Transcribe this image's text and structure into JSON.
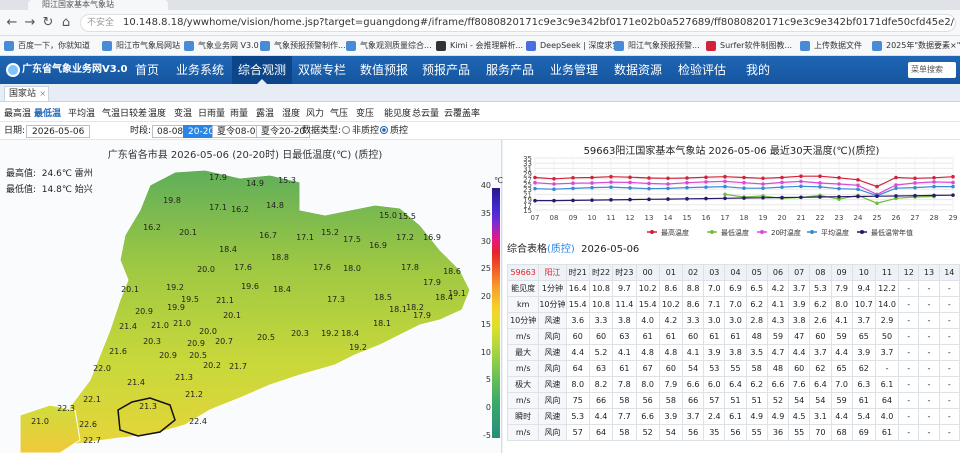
{
  "browser": {
    "tab_title": "阳江国家基本气象站",
    "url": "10.148.8.18/ywwhome/vision/home.jsp?target=guangdong#/iframe/ff8080820171c9e3c9e342bf0171e02b0a527689/ff8080820171c9e3c9e342bf0171dfe50cfd45e2/ff808082017512541254959d017517a0d43b630",
    "insecure_label": "不安全",
    "bookmarks": [
      "百度一下，你就知道",
      "阳江市气象局网站",
      "气象业务网 V3.0",
      "气象预报预警制作...",
      "气象观测质量综合...",
      "Kimi - 会推理解析...",
      "DeepSeek | 深度求索",
      "阳江气象预报预警...",
      "Surfer软件制图教...",
      "上传数据文件",
      "2025年\"数据要素×\"..."
    ]
  },
  "header": {
    "logo": "广东省气象业务网V3.0",
    "menu": [
      "首页",
      "业务系统",
      "综合观测",
      "双碳专栏",
      "数值预报",
      "预报产品",
      "服务产品",
      "业务管理",
      "数据资源",
      "检验评估",
      "我的"
    ],
    "active_menu": "综合观测",
    "search_placeholder": "菜单搜索"
  },
  "tabs": {
    "station_tab": "国家站"
  },
  "elements": {
    "items": [
      "最高温",
      "最低温",
      "平均温",
      "气温日较差",
      "温度",
      "变温",
      "日雨量",
      "雨量",
      "露温",
      "湿度",
      "风力",
      "气压",
      "变压",
      "能见度",
      "总云量",
      "云覆盖率"
    ],
    "active": "最低温"
  },
  "controls": {
    "date_label": "日期:",
    "date_value": "2026-05-06",
    "time_label": "时段:",
    "time_options": [
      "08-08",
      "20-20",
      "夏令08-08",
      "夏令20-20"
    ],
    "active_time": "20-20",
    "data_type_label": "数据类型:",
    "data_type_options": [
      "非质控",
      "质控"
    ],
    "active_data_type": "质控"
  },
  "map": {
    "title": "广东省各市县 2026-05-06 (20-20时) 日最低温度(℃) (质控)",
    "max_label": "最高值:",
    "max_value": "24.6℃ 雷州",
    "min_label": "最低值:",
    "min_value": "14.8℃ 始兴",
    "legend_unit": "℃",
    "legend_ticks": [
      "40",
      "35",
      "30",
      "25",
      "20",
      "15",
      "10",
      "5",
      "0",
      "-5"
    ],
    "stations": [
      "17.9",
      "14.9",
      "15.3",
      "19.8",
      "17.1",
      "16.2",
      "14.8",
      "15.0",
      "15.5",
      "16.2",
      "20.1",
      "16.7",
      "17.1",
      "15.2",
      "17.5",
      "16.9",
      "17.2",
      "16.9",
      "18.4",
      "20.0",
      "17.6",
      "18.8",
      "17.6",
      "18.0",
      "17.8",
      "18.6",
      "17.9",
      "20.1",
      "19.2",
      "19.6",
      "18.4",
      "19.9",
      "17.3",
      "18.5",
      "18.4",
      "19.5",
      "21.1",
      "18.1",
      "18.2",
      "19.1",
      "20.9",
      "21.0",
      "20.1",
      "18.1",
      "17.9",
      "21.4",
      "21.0",
      "20.0",
      "20.3",
      "19.2",
      "18.4",
      "20.3",
      "20.9",
      "20.7",
      "20.5",
      "19.2",
      "21.6",
      "20.9",
      "20.5",
      "22.0",
      "21.4",
      "21.3",
      "20.2",
      "21.7",
      "22.1",
      "21.2",
      "22.3",
      "21.3",
      "22.4",
      "22.6",
      "22.7",
      "21.0"
    ]
  },
  "chart_data": {
    "type": "line",
    "title": "59663阳江国家基本气象站  2026-05-06  最近30天温度(℃)(质控)",
    "x": [
      "07",
      "08",
      "09",
      "10",
      "11",
      "12",
      "13",
      "14",
      "15",
      "16",
      "17",
      "18",
      "19",
      "20",
      "21",
      "22",
      "23",
      "24",
      "25",
      "26",
      "27",
      "28",
      "29"
    ],
    "ylim": [
      15,
      35
    ],
    "yticks": [
      15,
      17,
      19,
      21,
      23,
      25,
      27,
      29,
      31,
      33,
      35
    ],
    "series": [
      {
        "name": "最高温度",
        "color": "#d2233b",
        "values": [
          27.5,
          27.0,
          27.4,
          27.5,
          27.8,
          27.6,
          27.3,
          27.2,
          27.3,
          27.6,
          27.8,
          27.5,
          27.2,
          27.5,
          28.0,
          28.0,
          27.4,
          26.6,
          24.0,
          27.5,
          27.2,
          27.4,
          27.8
        ]
      },
      {
        "name": "最低温度",
        "color": "#6fbf3a",
        "values": [
          null,
          null,
          null,
          null,
          null,
          null,
          null,
          null,
          null,
          null,
          21.0,
          20.0,
          20.4,
          19.5,
          19.8,
          20.6,
          19.2,
          20.6,
          17.6,
          19.5,
          20.0,
          20.2,
          null
        ]
      },
      {
        "name": "20时温度",
        "color": "#d84ad8",
        "values": [
          25.5,
          25.0,
          25.3,
          25.4,
          25.7,
          25.6,
          25.2,
          25.0,
          25.5,
          25.8,
          26.0,
          25.5,
          25.0,
          25.6,
          26.0,
          25.4,
          25.0,
          24.5,
          21.0,
          24.6,
          25.4,
          25.8,
          25.6
        ]
      },
      {
        "name": "平均温度",
        "color": "#3a8bd6",
        "values": [
          23.2,
          23.0,
          23.3,
          23.6,
          23.8,
          23.5,
          23.2,
          23.3,
          23.6,
          23.8,
          24.0,
          23.4,
          23.4,
          23.8,
          24.1,
          23.9,
          23.2,
          23.0,
          20.5,
          23.4,
          23.6,
          24.0,
          24.0
        ]
      },
      {
        "name": "最低温常年值",
        "color": "#2a1a6a",
        "values": [
          18.6,
          18.6,
          18.7,
          18.8,
          18.9,
          19.0,
          19.1,
          19.2,
          19.3,
          19.4,
          19.5,
          19.6,
          19.7,
          19.8,
          19.9,
          20.0,
          20.1,
          20.2,
          20.3,
          20.4,
          20.5,
          20.6,
          20.7
        ]
      }
    ]
  },
  "table": {
    "title_prefix": "综合表格",
    "qc_label": "(质控)",
    "date": "2026-05-06",
    "station_id": "59663",
    "station_name": "阳江",
    "hours": [
      "时21",
      "时22",
      "时23",
      "00",
      "01",
      "02",
      "03",
      "04",
      "05",
      "06",
      "07",
      "08",
      "09",
      "10",
      "11",
      "12",
      "13",
      "14"
    ],
    "rows": [
      {
        "label": "能见度",
        "sub": "1分钟",
        "values": [
          "16.4",
          "10.8",
          "9.7",
          "10.2",
          "8.6",
          "8.8",
          "7.0",
          "6.9",
          "6.5",
          "4.2",
          "3.7",
          "5.3",
          "7.9",
          "9.4",
          "12.2",
          "-",
          "-",
          "-"
        ]
      },
      {
        "label": "km",
        "sub": "10分钟",
        "values": [
          "15.4",
          "10.8",
          "11.4",
          "15.4",
          "10.2",
          "8.6",
          "7.1",
          "7.0",
          "6.2",
          "4.1",
          "3.9",
          "6.2",
          "8.0",
          "10.7",
          "14.0",
          "-",
          "-",
          "-"
        ]
      },
      {
        "label": "10分钟",
        "sub": "风速",
        "values": [
          "3.6",
          "3.3",
          "3.8",
          "4.0",
          "4.2",
          "3.3",
          "3.0",
          "3.0",
          "2.8",
          "4.3",
          "3.8",
          "2.6",
          "4.1",
          "3.7",
          "2.9",
          "-",
          "-",
          "-"
        ]
      },
      {
        "label": "m/s",
        "sub": "风向",
        "values": [
          "60",
          "60",
          "63",
          "61",
          "61",
          "60",
          "61",
          "61",
          "48",
          "59",
          "47",
          "60",
          "59",
          "65",
          "50",
          "-",
          "-",
          "-"
        ]
      },
      {
        "label": "最大",
        "sub": "风速",
        "values": [
          "4.4",
          "5.2",
          "4.1",
          "4.8",
          "4.8",
          "4.1",
          "3.9",
          "3.8",
          "3.5",
          "4.7",
          "4.4",
          "3.7",
          "4.4",
          "3.9",
          "3.7",
          "-",
          "-",
          "-"
        ]
      },
      {
        "label": "m/s",
        "sub": "风向",
        "values": [
          "64",
          "63",
          "61",
          "67",
          "60",
          "54",
          "53",
          "55",
          "58",
          "48",
          "60",
          "62",
          "65",
          "62",
          "-",
          "-",
          "-",
          "-"
        ]
      },
      {
        "label": "极大",
        "sub": "风速",
        "values": [
          "8.0",
          "8.2",
          "7.8",
          "8.0",
          "7.9",
          "6.6",
          "6.0",
          "6.4",
          "6.2",
          "6.6",
          "7.6",
          "6.4",
          "7.0",
          "6.3",
          "6.1",
          "-",
          "-",
          "-"
        ]
      },
      {
        "label": "m/s",
        "sub": "风向",
        "values": [
          "75",
          "66",
          "58",
          "56",
          "58",
          "66",
          "57",
          "51",
          "51",
          "52",
          "54",
          "54",
          "59",
          "61",
          "64",
          "-",
          "-",
          "-"
        ]
      },
      {
        "label": "瞬时",
        "sub": "风速",
        "values": [
          "5.3",
          "4.4",
          "7.7",
          "6.6",
          "3.9",
          "3.7",
          "2.4",
          "6.1",
          "4.9",
          "4.9",
          "4.5",
          "3.1",
          "4.4",
          "5.4",
          "4.0",
          "-",
          "-",
          "-"
        ]
      },
      {
        "label": "m/s",
        "sub": "风向",
        "values": [
          "57",
          "64",
          "58",
          "52",
          "54",
          "56",
          "35",
          "56",
          "55",
          "36",
          "55",
          "70",
          "68",
          "69",
          "61",
          "-",
          "-",
          "-"
        ]
      }
    ]
  }
}
